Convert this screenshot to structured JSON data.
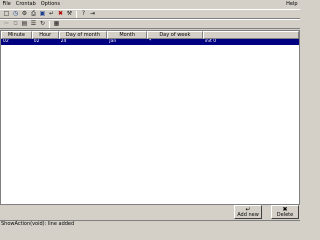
{
  "menu": {
    "file": "File",
    "crontab": "Crontab",
    "options": "Options",
    "help": "Help"
  },
  "toolbar1": [
    "new-icon",
    "clock-icon",
    "gear-icon",
    "print-icon",
    "save-icon",
    "undo-icon",
    "close-icon",
    "settings-icon",
    "help-icon",
    "exit-icon"
  ],
  "toolbar2": [
    "cut-icon",
    "copy-icon",
    "paste-icon",
    "list-icon",
    "refresh-icon",
    "window-icon"
  ],
  "table": {
    "columns": [
      "Minute",
      "Hour",
      "Day of month",
      "Month",
      "Day of week",
      ""
    ],
    "rows": [
      {
        "minute": "02",
        "hour": "02",
        "dom": "24",
        "month": "Jan",
        "dow": "*",
        "command": "init 0"
      }
    ]
  },
  "buttons": {
    "add": "Add new",
    "delete": "Delete"
  },
  "status": "ShowAction(void): line added"
}
